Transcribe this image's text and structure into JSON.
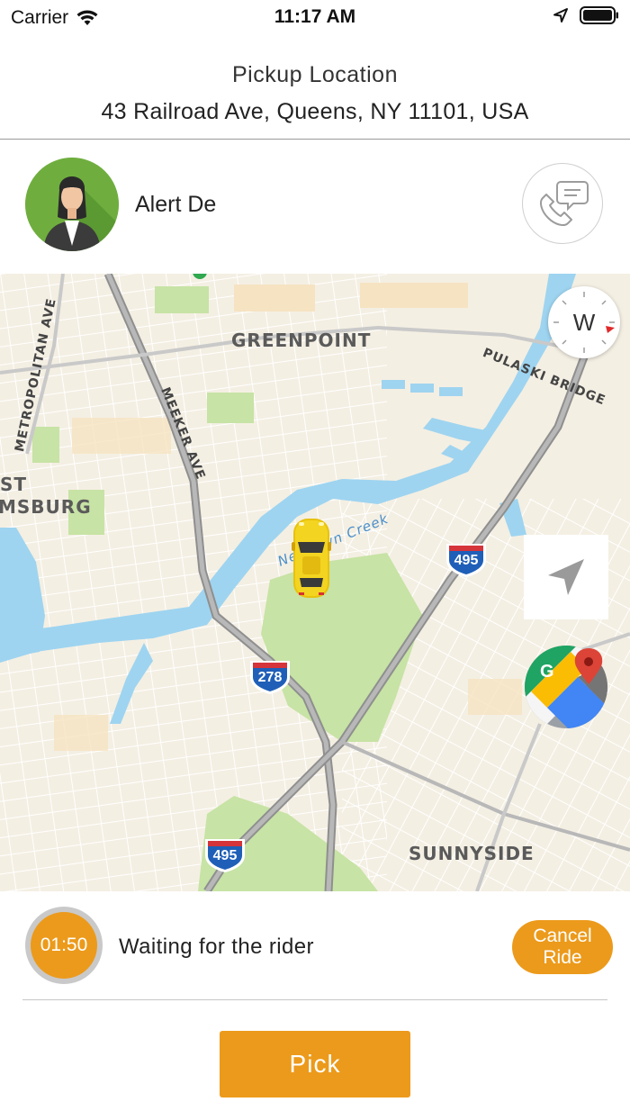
{
  "status_bar": {
    "carrier": "Carrier",
    "time": "11:17 AM"
  },
  "header": {
    "title": "Pickup Location",
    "address": "43 Railroad Ave, Queens, NY 11101, USA"
  },
  "rider": {
    "name": "Alert De"
  },
  "map": {
    "compass_letter": "W",
    "labels": {
      "greenpoint": "GREENPOINT",
      "pulaski_bridge": "PULASKI BRIDGE",
      "metropolitan_ave": "METROPOLITAN AVE",
      "meeker_ave": "MEEKER AVE",
      "east_williamsburg_1": "ST",
      "east_williamsburg_2": "MSBURG",
      "newtown_creek": "Newtown Creek",
      "sunnyside": "SUNNYSIDE"
    },
    "shields": {
      "i495_top": "495",
      "i278": "278",
      "i495_bottom": "495"
    }
  },
  "ride_status": {
    "timer": "01:50",
    "message": "Waiting for the rider",
    "cancel_label": "Cancel Ride"
  },
  "actions": {
    "pick_label": "Pick"
  },
  "colors": {
    "accent": "#EC9A1B",
    "water": "#9ED4F0",
    "park": "#C7E3A5"
  }
}
